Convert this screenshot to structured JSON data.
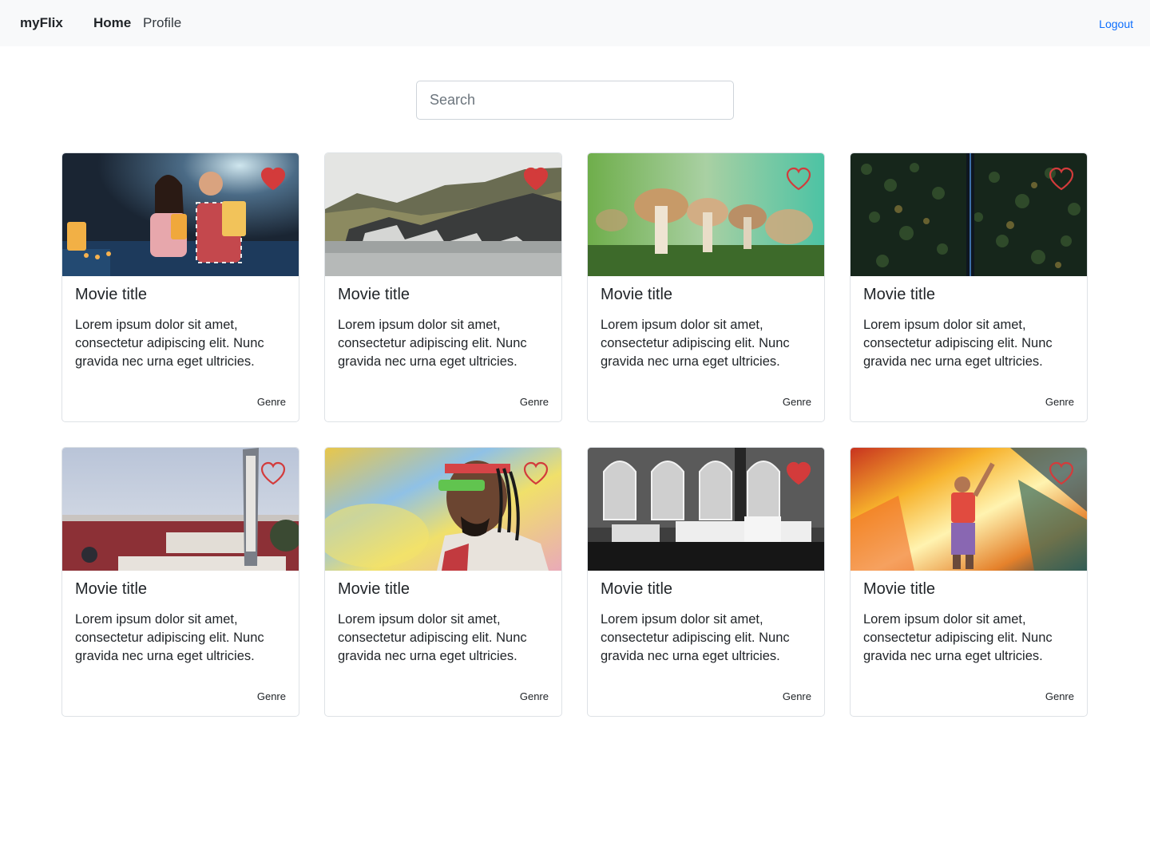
{
  "nav": {
    "brand": "myFlix",
    "links": [
      {
        "label": "Home",
        "active": true
      },
      {
        "label": "Profile",
        "active": false
      }
    ],
    "logout": "Logout"
  },
  "search": {
    "placeholder": "Search",
    "value": ""
  },
  "colors": {
    "heart": "#d33b3b",
    "link": "#0d6efd",
    "navbar_bg": "#f8f9fa"
  },
  "movies": [
    {
      "title": "Movie title",
      "description": "Lorem ipsum dolor sit amet, consectetur adipiscing elit. Nunc gravida nec urna eget ultricies.",
      "genre": "Genre",
      "favorite": true,
      "image": "couple-in-cinema"
    },
    {
      "title": "Movie title",
      "description": "Lorem ipsum dolor sit amet, consectetur adipiscing elit. Nunc gravida nec urna eget ultricies.",
      "genre": "Genre",
      "favorite": true,
      "image": "mountain-glacier-lake"
    },
    {
      "title": "Movie title",
      "description": "Lorem ipsum dolor sit amet, consectetur adipiscing elit. Nunc gravida nec urna eget ultricies.",
      "genre": "Genre",
      "favorite": false,
      "image": "mushrooms-closeup"
    },
    {
      "title": "Movie title",
      "description": "Lorem ipsum dolor sit amet, consectetur adipiscing elit. Nunc gravida nec urna eget ultricies.",
      "genre": "Genre",
      "favorite": false,
      "image": "aerial-forest-road"
    },
    {
      "title": "Movie title",
      "description": "Lorem ipsum dolor sit amet, consectetur adipiscing elit. Nunc gravida nec urna eget ultricies.",
      "genre": "Genre",
      "favorite": false,
      "image": "miracle-theater-sign"
    },
    {
      "title": "Movie title",
      "description": "Lorem ipsum dolor sit amet, consectetur adipiscing elit. Nunc gravida nec urna eget ultricies.",
      "genre": "Genre",
      "favorite": false,
      "image": "man-with-sunglasses"
    },
    {
      "title": "Movie title",
      "description": "Lorem ipsum dolor sit amet, consectetur adipiscing elit. Nunc gravida nec urna eget ultricies.",
      "genre": "Genre",
      "favorite": true,
      "image": "theater-marquee-bw"
    },
    {
      "title": "Movie title",
      "description": "Lorem ipsum dolor sit amet, consectetur adipiscing elit. Nunc gravida nec urna eget ultricies.",
      "genre": "Genre",
      "favorite": false,
      "image": "colorful-light-performer"
    }
  ]
}
